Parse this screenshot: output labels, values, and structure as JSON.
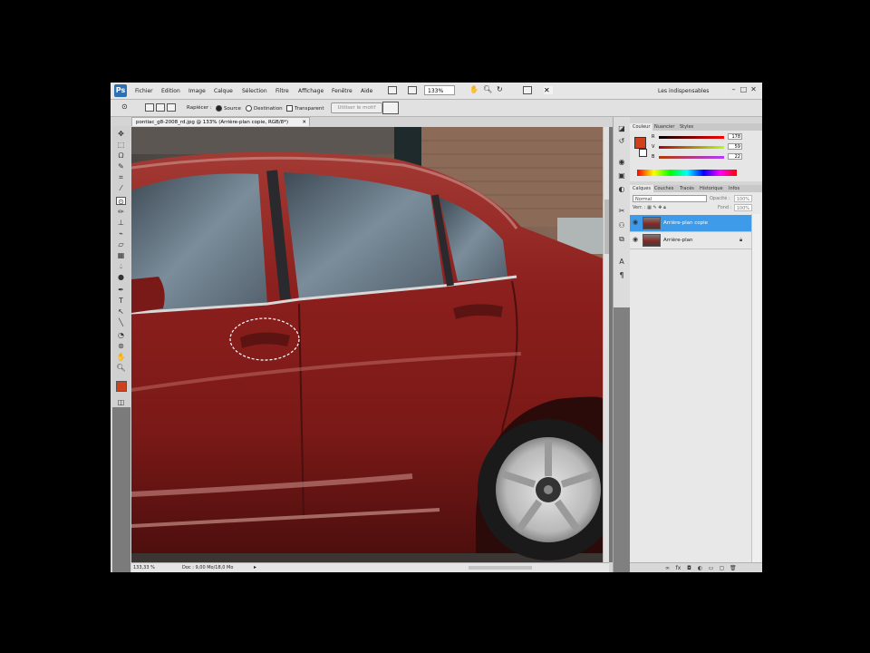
{
  "menubar": {
    "app_icon_label": "Ps",
    "items": [
      "Fichier",
      "Edition",
      "Image",
      "Calque",
      "Sélection",
      "Filtre",
      "Affichage",
      "Fenêtre",
      "Aide"
    ],
    "zoom": "133%",
    "workspace": "Les indispensables"
  },
  "options": {
    "sample_label": "Rapiécer :",
    "source_label": "Source",
    "destination_label": "Destination",
    "transparent_label": "Transparent",
    "use_pattern_label": "Utiliser le motif"
  },
  "document": {
    "tab_title": "pontiac_g8-2008_rd.jpg @ 133% (Arrière-plan copie, RGB/8*)",
    "zoom_status": "133,33 %",
    "doc_status": "Doc : 9,00 Mo/18,0 Mo"
  },
  "color_panel": {
    "tabs": [
      "Couleur",
      "Nuancier",
      "Styles"
    ],
    "channels": [
      {
        "name": "R",
        "value": "178"
      },
      {
        "name": "V",
        "value": "59"
      },
      {
        "name": "B",
        "value": "22"
      }
    ],
    "foreground_color": "#d0401a"
  },
  "layers_panel": {
    "tabs": [
      "Calques",
      "Couches",
      "Tracés",
      "Historique",
      "Infos"
    ],
    "blend_mode": "Normal",
    "opacity_label": "Opacité :",
    "opacity_value": "100%",
    "lock_label": "Verr. :",
    "fill_label": "Fond :",
    "fill_value": "100%",
    "layers": [
      {
        "name": "Arrière-plan copie",
        "selected": true
      },
      {
        "name": "Arrière-plan",
        "selected": false
      }
    ]
  },
  "colors": {
    "selection_blue": "#3d9be9",
    "car_red": "#8e1f1c"
  }
}
